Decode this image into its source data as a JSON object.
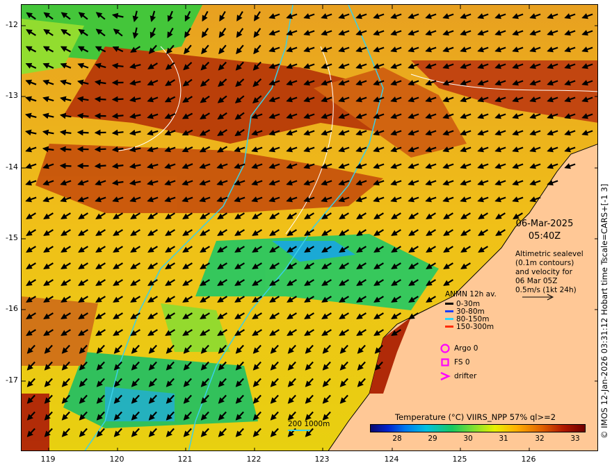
{
  "map": {
    "lon_ticks": [
      "119",
      "120",
      "121",
      "122",
      "123",
      "124",
      "125",
      "126"
    ],
    "lat_ticks": [
      "-12",
      "-13",
      "-14",
      "-15",
      "-16",
      "-17"
    ]
  },
  "annotation": {
    "date": "06-Mar-2025",
    "time": "05:40Z",
    "altimetry_lines": [
      "Altimetric sealevel",
      "(0.1m contours)",
      "and velocity for",
      "06 Mar 05Z",
      "0.5m/s (1kt 24h)"
    ]
  },
  "anmn_legend": {
    "title": "ANMN 12h av.",
    "items": [
      {
        "label": "0-30m",
        "color": "#000000"
      },
      {
        "label": "30-80m",
        "color": "#1a3cff"
      },
      {
        "label": "80-150m",
        "color": "#2ad8ff"
      },
      {
        "label": "150-300m",
        "color": "#ff2a00"
      }
    ]
  },
  "markers": {
    "argo": "Argo 0",
    "fs": "FS 0",
    "drifter": "drifter",
    "color": "#ff00ff"
  },
  "colorbar": {
    "title": "Temperature (°C) VIIRS_NPP 57% ql>=2",
    "ticks": [
      "28",
      "29",
      "30",
      "31",
      "32",
      "33"
    ]
  },
  "isobath_label": "200  1000m",
  "copyright": "© IMOS 12-Jan-2026 03:31:12 Hobart time Tscale=CARS+[-1 3]"
}
